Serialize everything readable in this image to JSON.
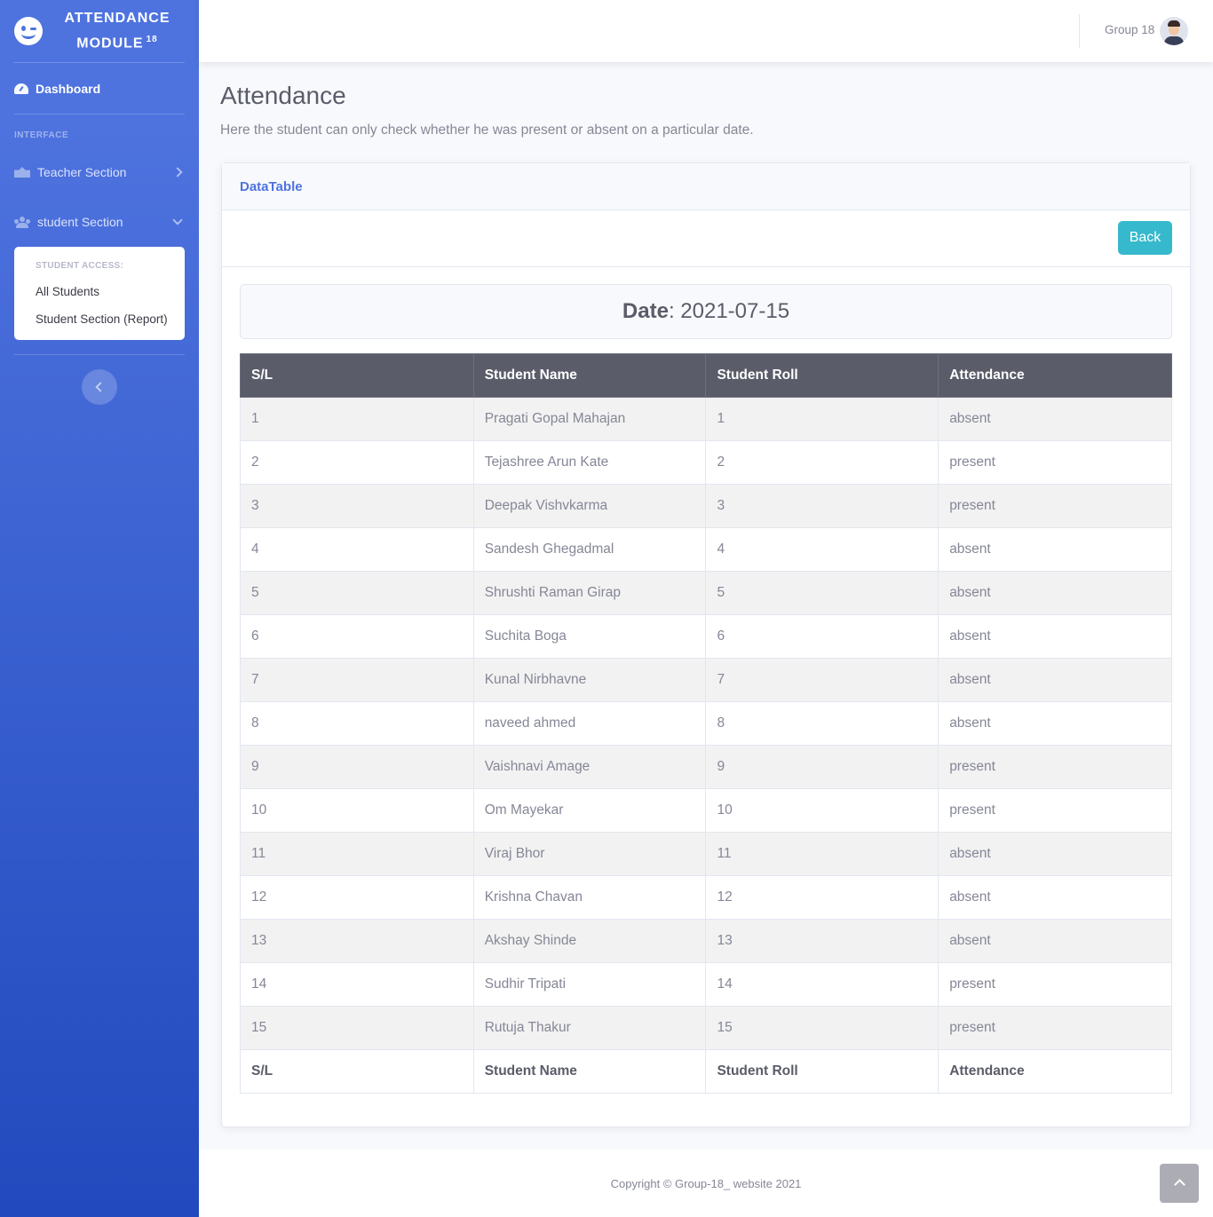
{
  "sidebar": {
    "brand_line1": "ATTENDANCE",
    "brand_line2": "MODULE",
    "brand_sup": "18",
    "dashboard_label": "Dashboard",
    "heading": "INTERFACE",
    "teacher_label": "Teacher Section",
    "student_label": "student Section",
    "collapse": {
      "header": "STUDENT ACCESS:",
      "items": [
        "All Students",
        "Student Section (Report)"
      ]
    }
  },
  "topbar": {
    "user_name": "Group 18"
  },
  "page": {
    "title": "Attendance",
    "description": "Here the student can only check whether he was present or absent on a particular date."
  },
  "card": {
    "header": "DataTable",
    "back_label": "Back",
    "date_label": "Date",
    "date_value": ": 2021-07-15"
  },
  "table": {
    "columns": [
      "S/L",
      "Student Name",
      "Student Roll",
      "Attendance"
    ],
    "rows": [
      [
        "1",
        "Pragati Gopal Mahajan",
        "1",
        "absent"
      ],
      [
        "2",
        "Tejashree Arun Kate",
        "2",
        "present"
      ],
      [
        "3",
        "Deepak Vishvkarma",
        "3",
        "present"
      ],
      [
        "4",
        "Sandesh Ghegadmal",
        "4",
        "absent"
      ],
      [
        "5",
        "Shrushti Raman Girap",
        "5",
        "absent"
      ],
      [
        "6",
        "Suchita Boga",
        "6",
        "absent"
      ],
      [
        "7",
        "Kunal Nirbhavne",
        "7",
        "absent"
      ],
      [
        "8",
        "naveed ahmed",
        "8",
        "absent"
      ],
      [
        "9",
        "Vaishnavi Amage",
        "9",
        "present"
      ],
      [
        "10",
        "Om Mayekar",
        "10",
        "present"
      ],
      [
        "11",
        "Viraj Bhor",
        "11",
        "absent"
      ],
      [
        "12",
        "Krishna Chavan",
        "12",
        "absent"
      ],
      [
        "13",
        "Akshay Shinde",
        "13",
        "absent"
      ],
      [
        "14",
        "Sudhir Tripati",
        "14",
        "present"
      ],
      [
        "15",
        "Rutuja Thakur",
        "15",
        "present"
      ]
    ]
  },
  "footer": {
    "copyright": "Copyright © Group-18_ website 2021"
  }
}
